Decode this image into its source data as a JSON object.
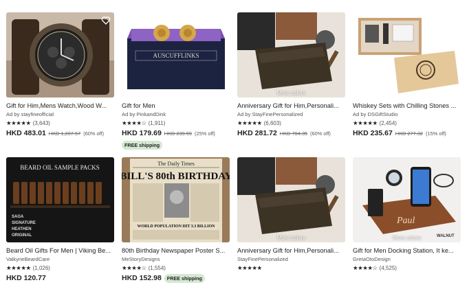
{
  "products": [
    {
      "title": "Gift for Him,Mens Watch,Wood W...",
      "seller": "Ad by stayfineofficial",
      "reviews": "(3,643)",
      "price": "HKD 483.01",
      "original_price": "HKD 1,207.57",
      "discount": "(60% off)",
      "free_shipping": ""
    },
    {
      "title": "Gift for Men",
      "seller": "Ad by PinkandDink",
      "reviews": "(1,911)",
      "price": "HKD 179.69",
      "original_price": "HKD 239.59",
      "discount": "(25% off)",
      "free_shipping": "FREE shipping",
      "image_text": "AUSCUFFLINKS"
    },
    {
      "title": "Anniversary Gift for Him,Personali...",
      "seller": "Ad by StayFinePersonalized",
      "reviews": "(6,603)",
      "price": "HKD 281.72",
      "original_price": "HKD 704.35",
      "discount": "(60% off)",
      "free_shipping": "",
      "badge": "More colors"
    },
    {
      "title": "Whiskey Sets with Chilling Stones ...",
      "seller": "Ad by DSGiftStudio",
      "reviews": "(2,454)",
      "price": "HKD 235.67",
      "original_price": "HKD 277.32",
      "discount": "(15% off)",
      "free_shipping": ""
    },
    {
      "title": "Beard Oil Gifts For Men | Viking Be...",
      "seller": "ValkyrieBeardCare",
      "reviews": "(1,026)",
      "price": "HKD 120.77",
      "original_price": "",
      "discount": "",
      "free_shipping": "",
      "image_title": "BEARD OIL SAMPLE PACKS",
      "image_labels": [
        "SAGA",
        "SIGNATURE",
        "HEATHEN",
        "ORIGINAL"
      ]
    },
    {
      "title": "80th Birthday Newspaper Poster S...",
      "seller": "MeStoryDesigns",
      "reviews": "(1,554)",
      "price": "HKD 152.98",
      "original_price": "",
      "discount": "",
      "free_shipping": "FREE shipping",
      "image_masthead": "The Daily Times",
      "image_headline": "BILL'S 80th BIRTHDAY",
      "image_sub": "WORLD POPULATION HIT 3.3 BILLION"
    },
    {
      "title": "Anniversary Gift for Him,Personali...",
      "seller": "StayFinePersonalized",
      "reviews": "",
      "price": "",
      "original_price": "",
      "discount": "",
      "free_shipping": "",
      "badge": "More colors"
    },
    {
      "title": "Gift for Men Docking Station, It ke...",
      "seller": "GretaOtoDesign",
      "reviews": "(4,525)",
      "price": "",
      "original_price": "",
      "discount": "",
      "free_shipping": "",
      "badge": "More colors",
      "image_name": "Paul",
      "image_brand": "WALNUT"
    }
  ],
  "stars": "★★★★★",
  "stars_4half": "★★★★☆"
}
